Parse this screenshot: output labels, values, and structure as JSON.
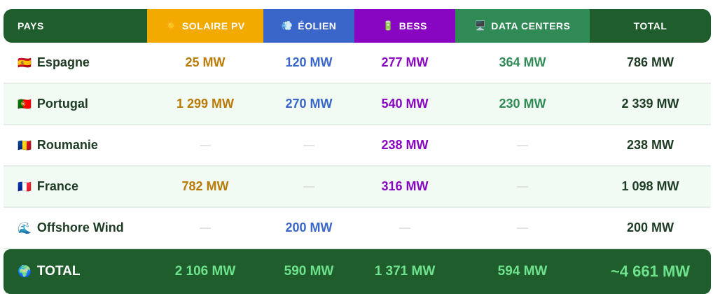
{
  "headers": {
    "country": "PAYS",
    "solar": "SOLAIRE PV",
    "wind": "ÉOLIEN",
    "bess": "BESS",
    "dc": "DATA CENTERS",
    "total": "TOTAL",
    "icons": {
      "solar": "sun-icon",
      "wind": "wind-icon",
      "bess": "battery-icon",
      "dc": "desktop-icon"
    }
  },
  "rows": [
    {
      "flag": "🇪🇸",
      "country": "Espagne",
      "solar": "25 MW",
      "wind": "120 MW",
      "bess": "277 MW",
      "dc": "364 MW",
      "total": "786 MW"
    },
    {
      "flag": "🇵🇹",
      "country": "Portugal",
      "solar": "1 299 MW",
      "wind": "270 MW",
      "bess": "540 MW",
      "dc": "230 MW",
      "total": "2 339 MW"
    },
    {
      "flag": "🇷🇴",
      "country": "Roumanie",
      "solar": "—",
      "wind": "—",
      "bess": "238 MW",
      "dc": "—",
      "total": "238 MW"
    },
    {
      "flag": "🇫🇷",
      "country": "France",
      "solar": "782 MW",
      "wind": "—",
      "bess": "316 MW",
      "dc": "—",
      "total": "1 098 MW"
    },
    {
      "flag": "🌊",
      "country": "Offshore Wind",
      "solar": "—",
      "wind": "200 MW",
      "bess": "—",
      "dc": "—",
      "total": "200 MW"
    }
  ],
  "totals": {
    "icon": "🌍",
    "label": "TOTAL",
    "solar": "2 106 MW",
    "wind": "590 MW",
    "bess": "1 371 MW",
    "dc": "594 MW",
    "total": "~4 661 MW"
  },
  "colors": {
    "header_green": "#1f5e2c",
    "solar": "#f2a900",
    "wind": "#3a66c9",
    "bess": "#8806c2",
    "dc": "#2f8a55",
    "total_value": "#6ee28c"
  }
}
